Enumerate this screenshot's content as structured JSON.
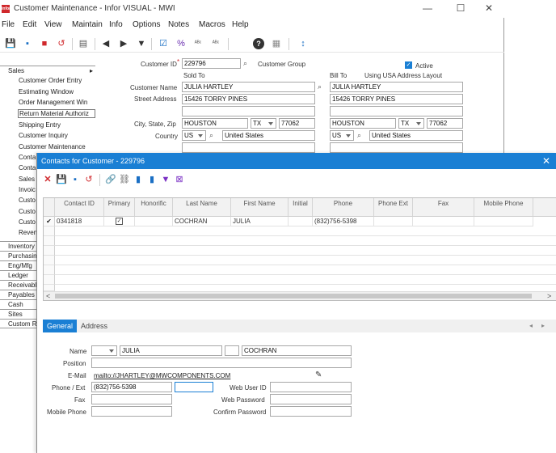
{
  "window": {
    "title": "Customer Maintenance - Infor VISUAL - MWI",
    "logo_text": "infor",
    "minimize": "—",
    "maximize": "☐",
    "close": "✕"
  },
  "menu": [
    "File",
    "Edit",
    "View",
    "Maintain",
    "Info",
    "Options",
    "Notes",
    "Macros",
    "Help"
  ],
  "toolbar_icons": {
    "save": "💾",
    "new": "▪",
    "delete": "■",
    "undo": "↺",
    "print": "▤",
    "first": "◀",
    "next": "▶",
    "dropdown": "▼",
    "checklist": "☑",
    "percent": "%",
    "spellcheck": "ᴬᴮᶜ",
    "abc2": "ᴬᴮᶜ",
    "help": "?",
    "calc": "▦",
    "sort": "↕"
  },
  "sidebar": {
    "sales_label": "Sales",
    "sales_arrow": "▸",
    "sales_items": [
      "Customer Order Entry",
      "Estimating Window",
      "Order Management Win",
      "Return Material Authoriz",
      "Shipping Entry",
      "Customer Inquiry",
      "Customer Maintenance",
      "Conta",
      "Conta",
      "Sales",
      "Invoic",
      "Custo",
      "Custo",
      "Custo",
      "Reven"
    ],
    "categories": [
      "Inventory",
      "Purchasin",
      "Eng/Mfg",
      "Ledger",
      "Receivabl",
      "Payables",
      "Cash",
      "Sites",
      "Custom R"
    ]
  },
  "customer_form": {
    "customer_id_label": "Customer ID",
    "required_mark": "*",
    "customer_id": "229796",
    "customer_group_label": "Customer Group",
    "active_label": "Active",
    "active_checked": true,
    "sold_to_label": "Sold To",
    "bill_to_label": "Bill To",
    "usa_address_label": "Using USA Address Layout",
    "customer_name_label": "Customer Name",
    "street_address_label": "Street Address",
    "city_state_zip_label": "City, State, Zip",
    "country_label": "Country",
    "sold_to": {
      "name": "JULIA HARTLEY",
      "street": "15426 TORRY PINES",
      "city": "HOUSTON",
      "state": "TX",
      "zip": "77062",
      "country_code": "US",
      "country": "United States"
    },
    "bill_to": {
      "name": "JULIA HARTLEY",
      "street": "15426 TORRY PINES",
      "city": "HOUSTON",
      "state": "TX",
      "zip": "77062",
      "country_code": "US",
      "country": "United States"
    }
  },
  "dialog": {
    "title": "Contacts for Customer  - 229796",
    "close": "✕",
    "toolbar_icons": [
      "✕",
      "💾",
      "▪",
      "↺",
      "🔗",
      "⛓",
      "▮",
      "▮",
      "▼",
      "⊠"
    ],
    "grid": {
      "headers": [
        "Contact ID",
        "Primary",
        "Honorific",
        "Last Name",
        "First Name",
        "Initial",
        "Phone",
        "Phone Ext",
        "Fax",
        "Mobile Phone"
      ],
      "rows": [
        {
          "contact_id": "0341818",
          "primary": true,
          "honorific": "",
          "last": "COCHRAN",
          "first": "JULIA",
          "initial": "",
          "phone": "(832)756-5398",
          "ext": "",
          "fax": "",
          "mobile": ""
        }
      ],
      "row_marker": "✔",
      "scroll_left": "<",
      "scroll_right": ">"
    },
    "tabs": [
      "General",
      "Address"
    ],
    "tab_nav_left": "◂",
    "tab_nav_right": "▸",
    "general": {
      "name_label": "Name",
      "first_name": "JULIA",
      "last_name": "COCHRAN",
      "position_label": "Position",
      "email_label": "E-Mail",
      "email": "mailto://JHARTLEY@MWCOMPONENTS.COM",
      "phone_ext_label": "Phone / Ext",
      "phone": "(832)756-5398",
      "fax_label": "Fax",
      "mobile_label": "Mobile Phone",
      "web_user_id_label": "Web User ID",
      "web_password_label": "Web Password",
      "confirm_password_label": "Confirm Password"
    }
  }
}
